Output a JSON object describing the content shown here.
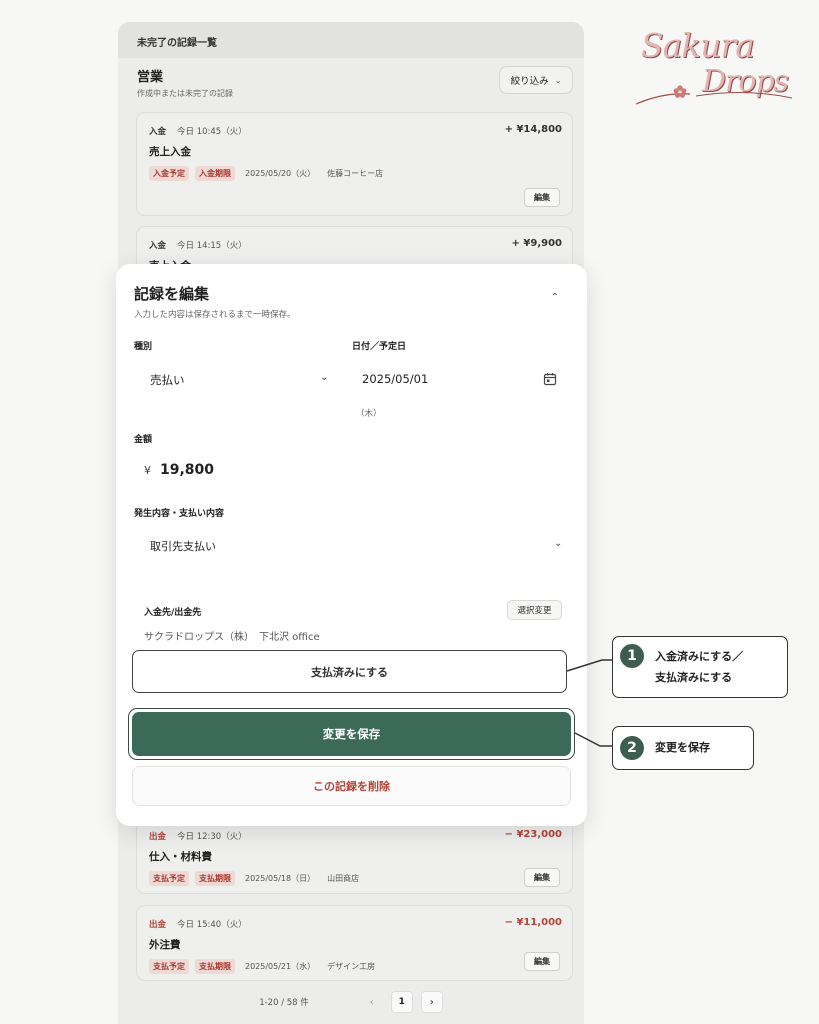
{
  "app": {
    "header_title": "未完了の記録一覧",
    "section_title": "営業",
    "section_subtitle": "作成中または未完了の記録",
    "filter_label": "絞り込み"
  },
  "records_top": [
    {
      "type": "入金",
      "time": "今日 10:45（火）",
      "amount": "+ ¥14,800",
      "title": "売上入金",
      "tags": [
        "入金予定",
        "入金期限"
      ],
      "date": "2025/05/20（火）",
      "party": "佐藤コーヒー店",
      "edit_label": "編集"
    },
    {
      "type": "入金",
      "time": "今日 14:15（火）",
      "amount": "+ ¥9,900",
      "title": "売上入金"
    }
  ],
  "records_bottom": [
    {
      "type": "出金",
      "time": "今日 12:30（火）",
      "amount": "− ¥23,000",
      "title": "仕入・材料費",
      "tags": [
        "支払予定",
        "支払期限"
      ],
      "date": "2025/05/18（日）",
      "party": "山田商店",
      "edit_label": "編集"
    },
    {
      "type": "出金",
      "time": "今日 15:40（火）",
      "amount": "− ¥11,000",
      "title": "外注費",
      "tags": [
        "支払予定",
        "支払期限"
      ],
      "date": "2025/05/21（水）",
      "party": "デザイン工房",
      "edit_label": "編集"
    }
  ],
  "pagination": {
    "info": "1-20 / 58 件",
    "current": "1"
  },
  "logo": {
    "line1": "Sakura",
    "line2": "Drops"
  },
  "modal": {
    "title": "記録を編集",
    "subtitle": "入力した内容は保存されるまで一時保存。",
    "type_label": "種別",
    "type_value": "売払い",
    "date_label": "日付／予定日",
    "date_value": "2025/05/01",
    "weekday": "（木）",
    "amount_label": "金額",
    "currency": "¥",
    "amount_value": "19,800",
    "content_label": "発生内容・支払い内容",
    "content_value": "取引先支払い",
    "party_label": "入金先/出金先",
    "change_label": "選択変更",
    "party_value": "サクラドロップス（株）　下北沢 office",
    "paid_button": "支払済みにする",
    "save_button": "変更を保存",
    "delete_button": "この記録を削除"
  },
  "callouts": [
    {
      "num": "1",
      "line1": "入金済みにする／",
      "line2": "支払済みにする"
    },
    {
      "num": "2",
      "line1": "変更を保存"
    }
  ],
  "colors": {
    "primary": "#3c6a58",
    "danger": "#b04438",
    "tag_bg": "#efd9d5",
    "callout_badge": "#3c5d4f"
  }
}
